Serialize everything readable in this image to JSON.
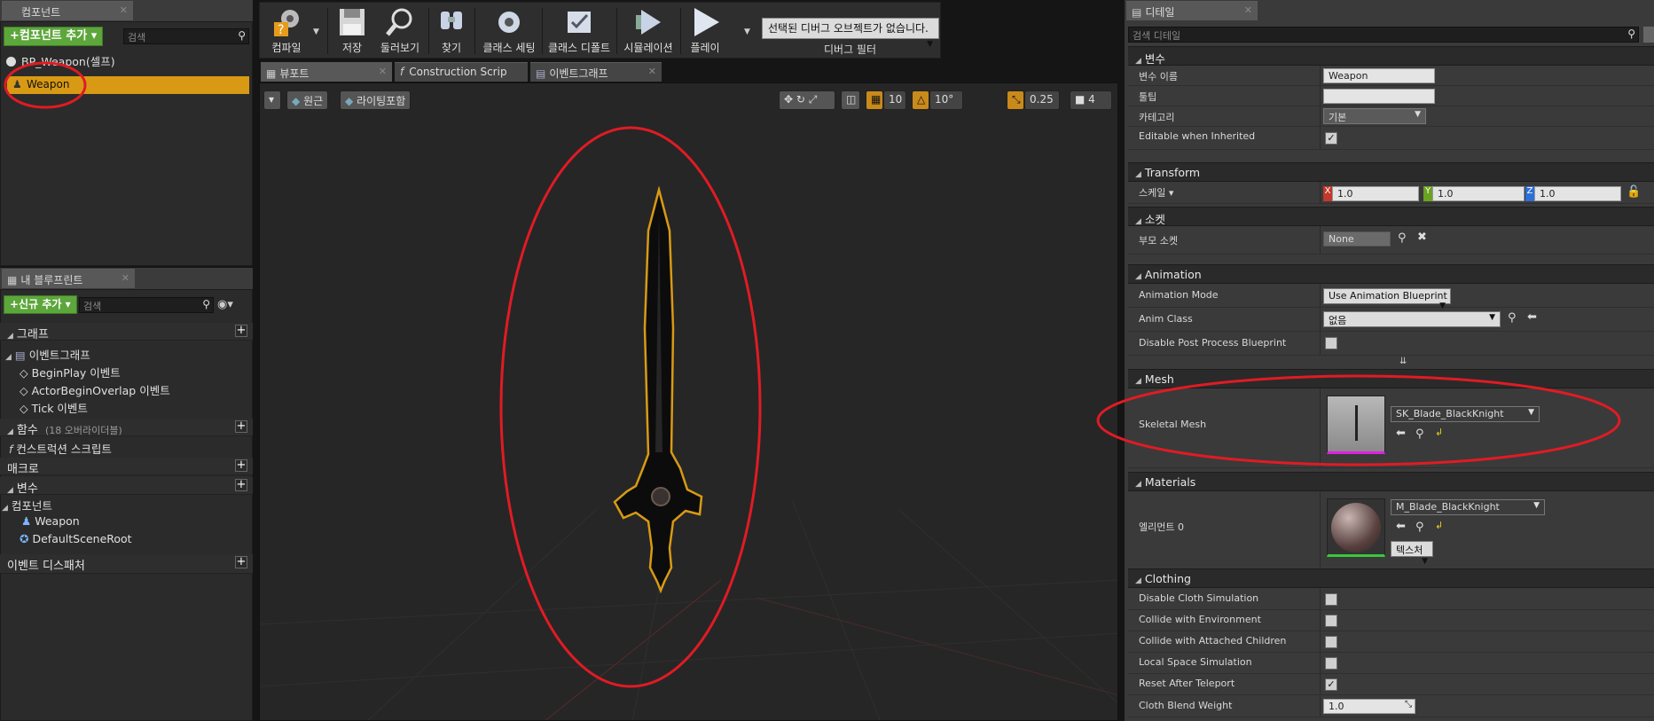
{
  "components_panel": {
    "tab_label": "컴포넌트",
    "add_button": "+컴포넌트 추가 ▾",
    "search_placeholder": "검색",
    "self_item": "BP_Weapon(셀프)",
    "selected_item": "Weapon"
  },
  "blueprint_panel": {
    "tab_label": "내 블루프린트",
    "new_button": "+신규 추가 ▾",
    "search_placeholder": "검색",
    "sections": {
      "graph": "그래프",
      "event_graph": "이벤트그래프",
      "events": [
        "BeginPlay 이벤트",
        "ActorBeginOverlap 이벤트",
        "Tick 이벤트"
      ],
      "functions": "함수",
      "functions_note": "(18 오버라이더블)",
      "construction_script": "컨스트럭션 스크립트",
      "macros": "매크로",
      "variables": "변수",
      "components": "컴포넌트",
      "component_items": [
        "Weapon",
        "DefaultSceneRoot"
      ],
      "event_dispatchers": "이벤트 디스패처"
    }
  },
  "toolbar": {
    "compile": "컴파일",
    "save": "저장",
    "browse": "둘러보기",
    "find": "찾기",
    "class_settings": "클래스 세팅",
    "class_defaults": "클래스 디폴트",
    "simulation": "시뮬레이션",
    "play": "플레이",
    "debug_object": "선택된 디버그 오브젝트가 없습니다.",
    "debug_filter": "디버그 필터"
  },
  "editor_tabs": [
    "뷰포트",
    "Construction Scrip",
    "이벤트그래프"
  ],
  "viewport": {
    "perspective": "원근",
    "lighting": "라이팅포함",
    "grid_snap": "10",
    "rot_snap": "10°",
    "scale_snap": "0.25",
    "camera_speed": "4"
  },
  "details": {
    "tab_label": "디테일",
    "search_placeholder": "검색 디테일",
    "variables": {
      "title": "변수",
      "name_label": "변수 이름",
      "name_value": "Weapon",
      "tooltip_label": "툴팁",
      "tooltip_value": "",
      "category_label": "카테고리",
      "category_value": "기본",
      "editable_label": "Editable when Inherited"
    },
    "transform": {
      "title": "Transform",
      "scale_label": "스케일 ▾",
      "x": "1.0",
      "y": "1.0",
      "z": "1.0",
      "x_label": "X",
      "y_label": "Y",
      "z_label": "Z"
    },
    "sockets": {
      "title": "소켓",
      "parent_label": "부모 소켓",
      "parent_value": "None"
    },
    "animation": {
      "title": "Animation",
      "mode_label": "Animation Mode",
      "mode_value": "Use Animation Blueprint",
      "class_label": "Anim Class",
      "class_value": "없음",
      "disable_pp_label": "Disable Post Process Blueprint"
    },
    "mesh": {
      "title": "Mesh",
      "skeletal_label": "Skeletal Mesh",
      "skeletal_value": "SK_Blade_BlackKnight"
    },
    "materials": {
      "title": "Materials",
      "element_label": "엘리먼트 0",
      "element_value": "M_Blade_BlackKnight",
      "textures": "텍스처"
    },
    "clothing": {
      "title": "Clothing",
      "rows": [
        {
          "label": "Disable Cloth Simulation",
          "checked": false
        },
        {
          "label": "Collide with Environment",
          "checked": false
        },
        {
          "label": "Collide with Attached Children",
          "checked": false
        },
        {
          "label": "Local Space Simulation",
          "checked": false
        },
        {
          "label": "Reset After Teleport",
          "checked": true
        }
      ],
      "blend_label": "Cloth Blend Weight",
      "blend_value": "1.0"
    }
  },
  "colors": {
    "selection": "#d89a14",
    "annotation": "#e01b24",
    "green_button": "#5ca63b"
  }
}
